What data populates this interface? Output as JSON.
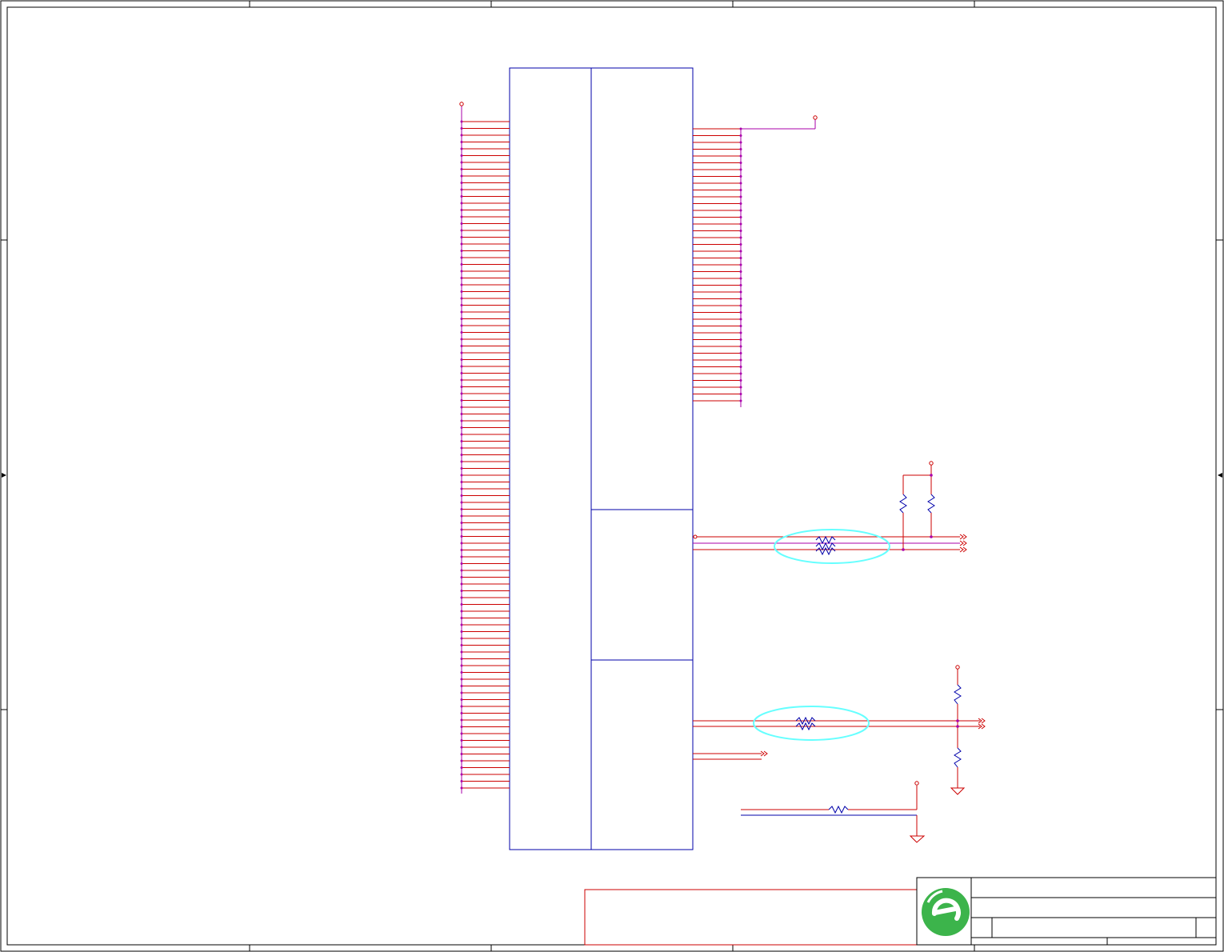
{
  "colors": {
    "background": "#ffffff",
    "frame": "#000000",
    "component_outline": "#0000aa",
    "wire": "#cc0000",
    "bus_wire": "#aa00aa",
    "highlight": "#66ffff",
    "logo": "#3cb44b",
    "title_box": "#cc0000"
  },
  "icons": {
    "logo": "company-logo-icon",
    "resistor": "resistor-icon",
    "ground": "ground-icon",
    "power_pin": "power-port-icon",
    "off_sheet_connector": "off-sheet-arrow-icon"
  }
}
